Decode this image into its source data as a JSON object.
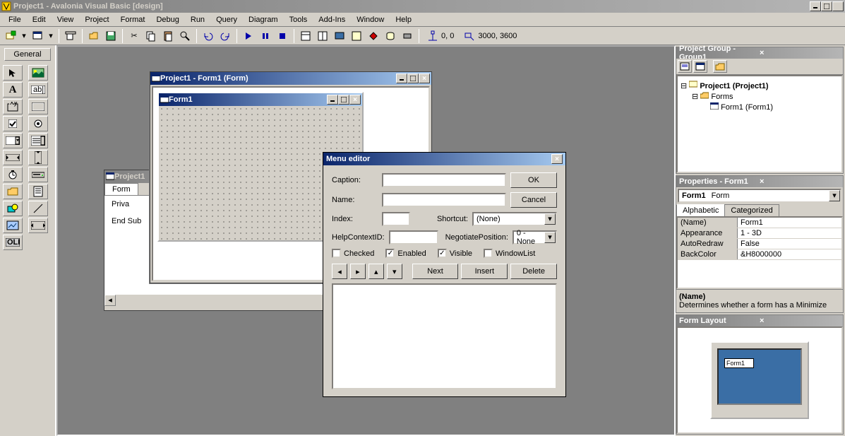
{
  "app": {
    "title": "Project1 - Avalonia Visual Basic [design]"
  },
  "menus": [
    "File",
    "Edit",
    "View",
    "Project",
    "Format",
    "Debug",
    "Run",
    "Query",
    "Diagram",
    "Tools",
    "Add-Ins",
    "Window",
    "Help"
  ],
  "status": {
    "pos": "0, 0",
    "size": "3000, 3600"
  },
  "toolbox": {
    "tab": "General"
  },
  "form_designer": {
    "title": "Project1 - Form1 (Form)",
    "inner_title": "Form1"
  },
  "code": {
    "title": "Project1",
    "tab": "Form",
    "line1": "Priva",
    "line2": "End Sub"
  },
  "menu_editor": {
    "title": "Menu editor",
    "labels": {
      "caption": "Caption:",
      "name": "Name:",
      "index": "Index:",
      "shortcut": "Shortcut:",
      "help": "HelpContextID:",
      "negotiate": "NegotiatePosition:"
    },
    "shortcut_val": "(None)",
    "negotiate_val": "0 - None",
    "checks": {
      "checked": "Checked",
      "enabled": "Enabled",
      "visible": "Visible",
      "windowlist": "WindowList"
    },
    "check_state": {
      "checked": false,
      "enabled": true,
      "visible": true,
      "windowlist": false
    },
    "buttons": {
      "ok": "OK",
      "cancel": "Cancel",
      "next": "Next",
      "insert": "Insert",
      "delete": "Delete"
    }
  },
  "project_panel": {
    "title": "Project Group - Group1",
    "root": "Project1 (Project1)",
    "folder": "Forms",
    "form": "Form1 (Form1)"
  },
  "props_panel": {
    "title": "Properties - Form1",
    "obj_name": "Form1",
    "obj_type": "Form",
    "tabs": {
      "a": "Alphabetic",
      "c": "Categorized"
    },
    "rows": [
      {
        "n": "(Name)",
        "v": "Form1"
      },
      {
        "n": "Appearance",
        "v": "1 - 3D"
      },
      {
        "n": "AutoRedraw",
        "v": "False"
      },
      {
        "n": "BackColor",
        "v": "&H8000000"
      }
    ],
    "desc_name": "(Name)",
    "desc_text": "Determines whether a form has a Minimize"
  },
  "layout_panel": {
    "title": "Form Layout",
    "form": "Form1"
  }
}
